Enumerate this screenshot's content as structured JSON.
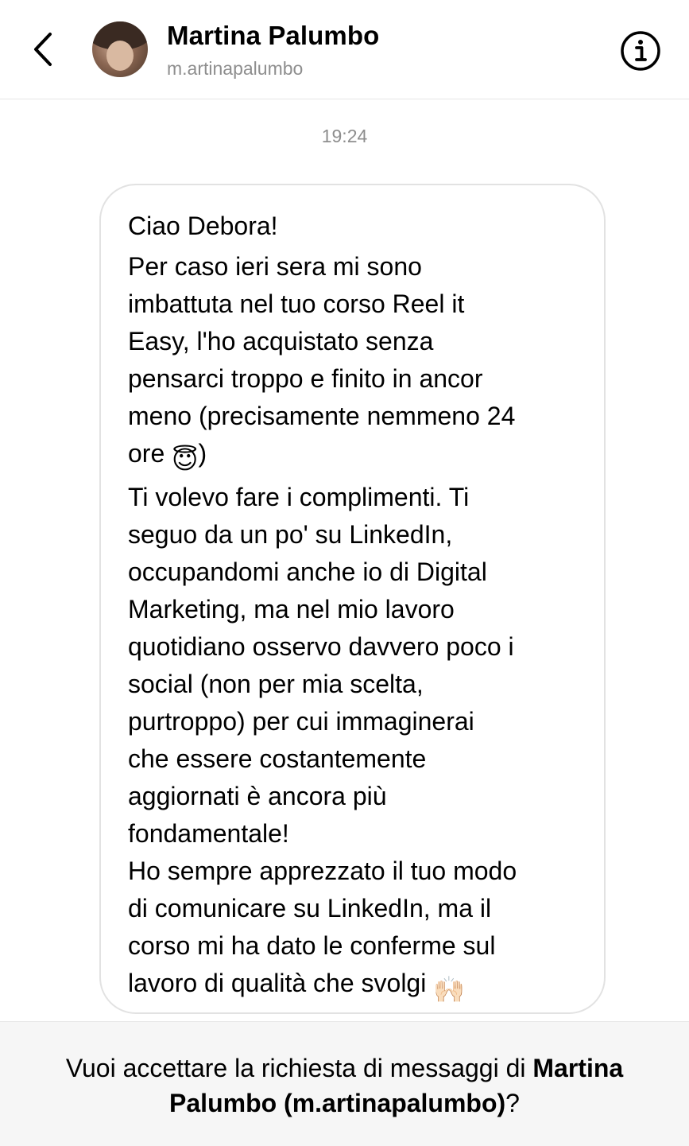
{
  "header": {
    "name": "Martina Palumbo",
    "username": "m.artinapalumbo",
    "back_icon": "chevron-left-icon",
    "info_icon": "info-circle-icon"
  },
  "timestamp": "19:24",
  "message": {
    "line1": "Ciao Debora!",
    "para1": "Per caso ieri sera mi sono\nimbattuta nel tuo corso Reel it\nEasy, l'ho acquistato senza\npensarci troppo e finito in ancor\nmeno (precisamente nemmeno 24\nore",
    "para1_end": ")",
    "emoji1": "😇",
    "para2": "Ti volevo fare i complimenti. Ti\nseguo da un po' su LinkedIn,\noccupandomi anche io di Digital\nMarketing, ma nel mio lavoro\nquotidiano osservo davvero poco i\nsocial (non per mia scelta,\npurtroppo) per cui immaginerai\nche essere costantemente\naggiornati è ancora più\nfondamentale!",
    "para3": "Ho sempre apprezzato il tuo modo\ndi comunicare su LinkedIn, ma il\ncorso mi ha dato le conferme sul\nlavoro di qualità che svolgi",
    "emoji2": "🙌🏻"
  },
  "request": {
    "prefix": "Vuoi accettare la richiesta di messaggi di ",
    "name_bold": "Martina Palumbo (m.artinapalumbo)",
    "suffix": "?"
  }
}
